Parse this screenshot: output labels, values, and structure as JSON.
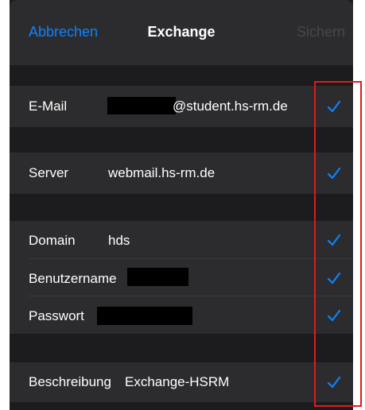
{
  "nav": {
    "cancel_label": "Abbrechen",
    "title": "Exchange",
    "save_label": "Sichern"
  },
  "fields": {
    "email": {
      "label": "E-Mail",
      "value_suffix": "@student.hs-rm.de",
      "checked": true
    },
    "server": {
      "label": "Server",
      "value": "webmail.hs-rm.de",
      "checked": true
    },
    "domain": {
      "label": "Domain",
      "value": "hds",
      "checked": true
    },
    "username": {
      "label": "Benutzername",
      "value": "",
      "checked": true
    },
    "password": {
      "label": "Passwort",
      "value": "",
      "checked": true
    },
    "description": {
      "label": "Beschreibung",
      "value": "Exchange-HSRM",
      "checked": true
    }
  },
  "colors": {
    "accent": "#0a84ff",
    "highlight": "#e01b1b",
    "background": "#1c1c1e",
    "cell": "#2c2c2e"
  }
}
